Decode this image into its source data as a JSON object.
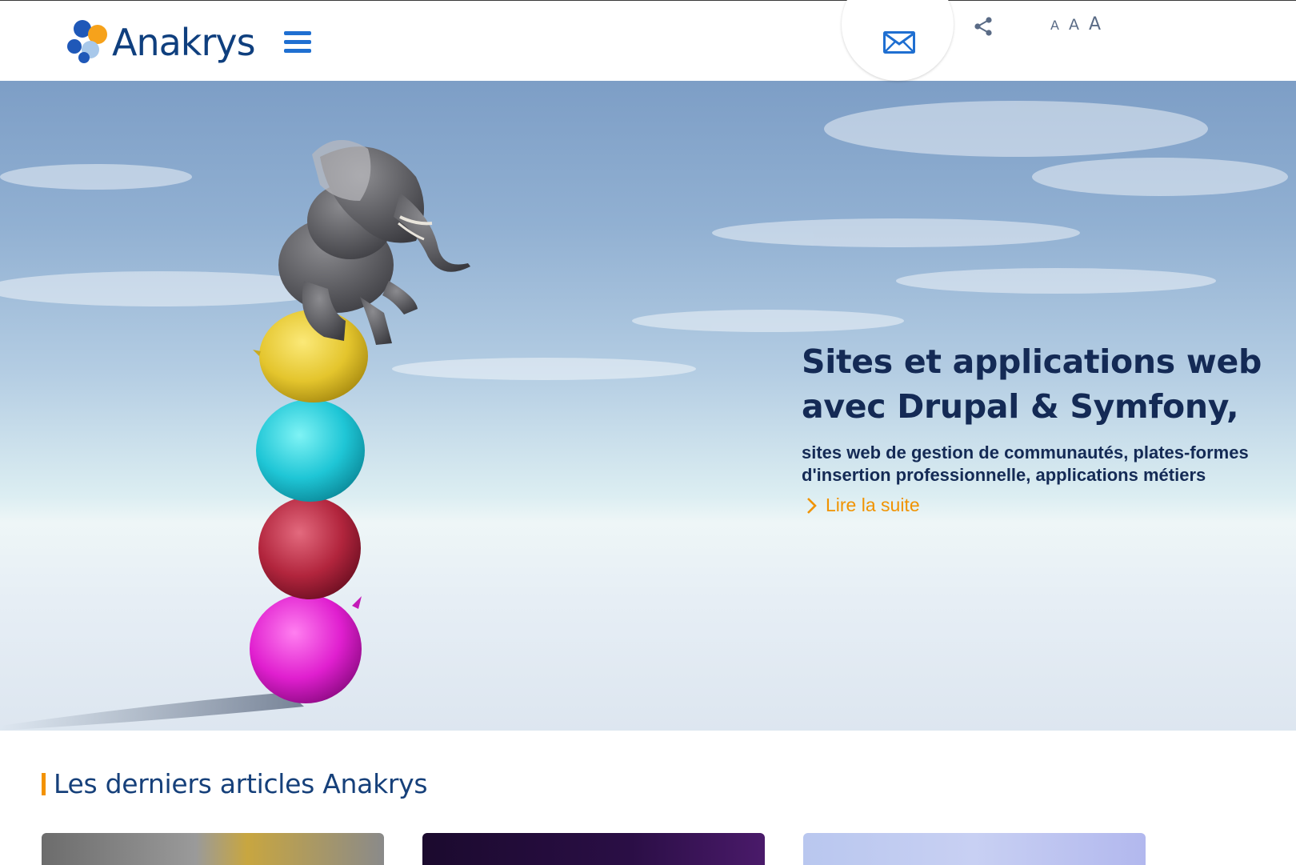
{
  "brand": {
    "name": "Anakrys",
    "colors": {
      "navy": "#142a55",
      "blue": "#1f6fd1",
      "orange": "#f39200"
    }
  },
  "header": {
    "menu_icon": "hamburger-menu-icon",
    "contact_icon": "envelope-icon",
    "share_icon": "share-icon",
    "font_sizes": [
      "A",
      "A",
      "A"
    ]
  },
  "hero": {
    "title": "Sites et applications web avec Drupal & Symfony,",
    "subtitle": "sites web de gestion de communautés, plates-formes d'insertion professionnelle, applications métiers",
    "link_label": "Lire la suite",
    "link_icon": "chevron-right-icon"
  },
  "articles": {
    "title": "Les derniers articles Anakrys"
  }
}
